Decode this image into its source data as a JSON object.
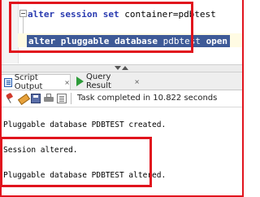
{
  "editor": {
    "line1": {
      "keyword": "alter session set",
      "rest": " container=pdbtest"
    },
    "line2": {
      "keyword": "alter pluggable database",
      "name": " pdbtest ",
      "keyword2": "open"
    }
  },
  "tabs": [
    {
      "label": "Script Output",
      "close": "×",
      "icon": "script-output-icon"
    },
    {
      "label": "Query Result",
      "close": "×",
      "icon": "run-icon"
    }
  ],
  "toolbar": {
    "status": "Task completed in 10.822 seconds",
    "icons": [
      "pin-icon",
      "eraser-icon",
      "save-icon",
      "print-icon",
      "open-file-icon"
    ]
  },
  "output": {
    "lines": [
      "Pluggable database PDBTEST created.",
      "Session altered.",
      "Pluggable database PDBTEST altered."
    ]
  },
  "colors": {
    "highlight_box": "#e1141d",
    "selection": "#3e5a97",
    "keyword": "#2a3bb0"
  }
}
